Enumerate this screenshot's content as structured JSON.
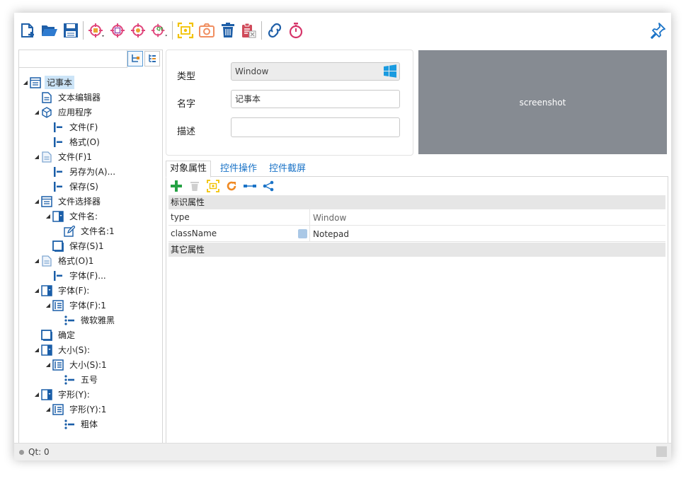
{
  "toolbar": {
    "icons": [
      "new-file-icon",
      "open-folder-icon",
      "save-icon",
      "windows-capture-icon",
      "uia-capture-icon",
      "web-capture-icon",
      "qt-capture-icon",
      "screenshot-select-icon",
      "camera-icon",
      "trash-icon",
      "clipboard-clean-icon",
      "link-icon",
      "stopwatch-icon",
      "pin-icon"
    ],
    "qt_badge": "Qt"
  },
  "tree": {
    "nodes": [
      {
        "label": "记事本",
        "icon": "window-icon",
        "selected": true
      },
      {
        "label": "文本编辑器",
        "icon": "document-icon"
      },
      {
        "label": "应用程序",
        "icon": "cube-icon"
      },
      {
        "label": "文件(F)",
        "icon": "menu-item-icon"
      },
      {
        "label": "格式(O)",
        "icon": "menu-item-icon"
      },
      {
        "label": "文件(F)1",
        "icon": "menu-icon"
      },
      {
        "label": "另存为(A)...",
        "icon": "menu-item-icon"
      },
      {
        "label": "保存(S)",
        "icon": "menu-item-icon"
      },
      {
        "label": "文件选择器",
        "icon": "window-icon"
      },
      {
        "label": "文件名:",
        "icon": "combobox-icon"
      },
      {
        "label": "文件名:1",
        "icon": "edit-icon"
      },
      {
        "label": "保存(S)1",
        "icon": "button-icon"
      },
      {
        "label": "格式(O)1",
        "icon": "menu-icon"
      },
      {
        "label": "字体(F)...",
        "icon": "menu-item-icon"
      },
      {
        "label": "字体(F):",
        "icon": "combobox-icon"
      },
      {
        "label": "字体(F):1",
        "icon": "list-icon"
      },
      {
        "label": "微软雅黑",
        "icon": "list-item-icon"
      },
      {
        "label": "确定",
        "icon": "button-icon"
      },
      {
        "label": "大小(S):",
        "icon": "combobox-icon"
      },
      {
        "label": "大小(S):1",
        "icon": "list-icon"
      },
      {
        "label": "五号",
        "icon": "list-item-icon"
      },
      {
        "label": "字形(Y):",
        "icon": "combobox-icon"
      },
      {
        "label": "字形(Y):1",
        "icon": "list-icon"
      },
      {
        "label": "粗体",
        "icon": "list-item-icon"
      }
    ]
  },
  "info": {
    "type_label": "类型",
    "type_value": "Window",
    "name_label": "名字",
    "name_value": "记事本",
    "desc_label": "描述",
    "desc_value": ""
  },
  "screenshot": {
    "text": "screenshot"
  },
  "tabs": [
    {
      "label": "对象属性",
      "active": true
    },
    {
      "label": "控件操作"
    },
    {
      "label": "控件截屏"
    }
  ],
  "props": {
    "group1": "标识属性",
    "rows": [
      {
        "name": "type",
        "value": "Window",
        "readonly": true
      },
      {
        "name": "className",
        "value": "Notepad",
        "readonly": false
      }
    ],
    "group2": "其它属性"
  },
  "status": {
    "text": "Qt: 0"
  }
}
